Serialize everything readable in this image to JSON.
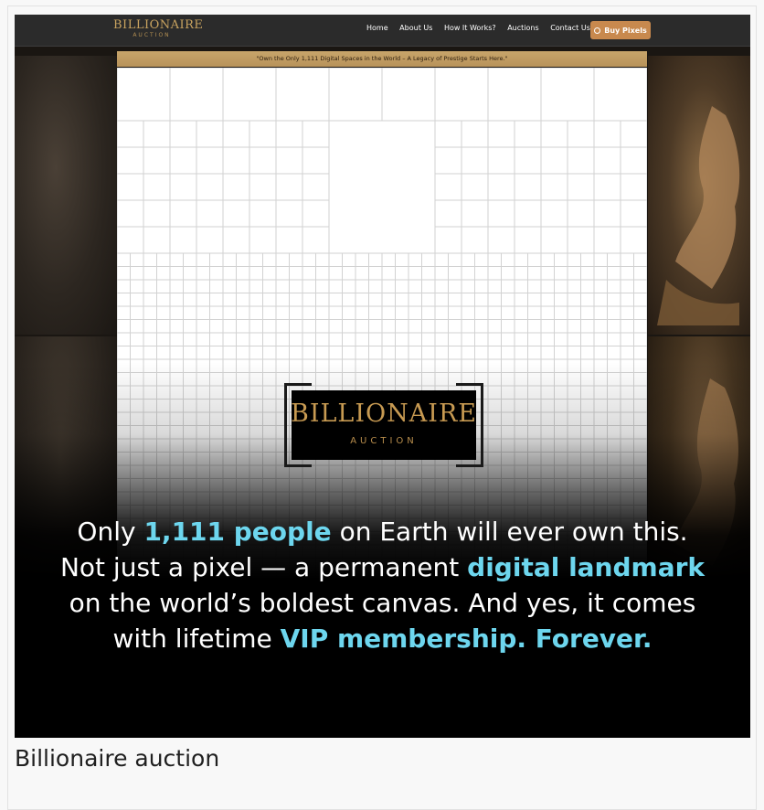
{
  "site": {
    "brand_main": "BILLIONAIRE",
    "brand_sub": "AUCTION",
    "nav": [
      "Home",
      "About Us",
      "How It Works?",
      "Auctions",
      "Contact Us"
    ],
    "cta_label": "Buy Pixels",
    "ribbon": "\"Own the Only 1,111 Digital Spaces in the World – A Legacy of Prestige Starts Here.\""
  },
  "logo": {
    "main": "BILLIONAIRE",
    "sub": "AUCTION"
  },
  "caption": {
    "t1": "Only ",
    "h1": "1,111 people",
    "t2": " on Earth will ever own this. Not just a pixel — a permanent ",
    "h2": "digital landmark",
    "t3": " on the world’s boldest canvas. And yes, it comes with lifetime ",
    "h3": "VIP membership. Forever."
  },
  "figure_title": "Billionaire auction",
  "colors": {
    "accent": "#c8894e",
    "highlight": "#6dd6ee",
    "gold": "#c79a52"
  }
}
